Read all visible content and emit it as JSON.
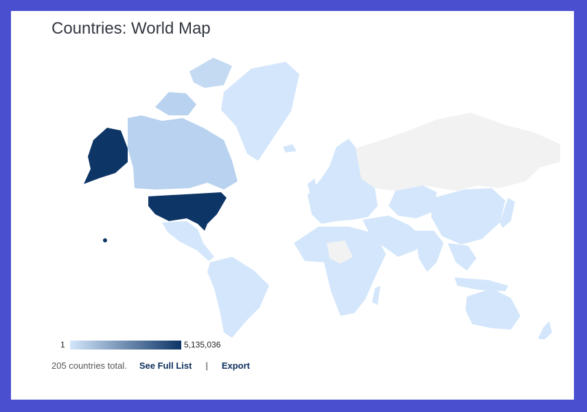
{
  "title": "Countries: World Map",
  "legend": {
    "min": "1",
    "max": "5,135,036",
    "color_low": "#d3e6fb",
    "color_high": "#0d3566"
  },
  "footer": {
    "total": "205 countries total.",
    "see_full_list": "See Full List",
    "separator": "|",
    "export": "Export"
  },
  "colors": {
    "background": "#4a4fd0",
    "no_data": "#f2f2f2",
    "tier_low": "#d3e6fb",
    "tier_mid": "#b8d2ef",
    "tier_high": "#0d3566"
  }
}
